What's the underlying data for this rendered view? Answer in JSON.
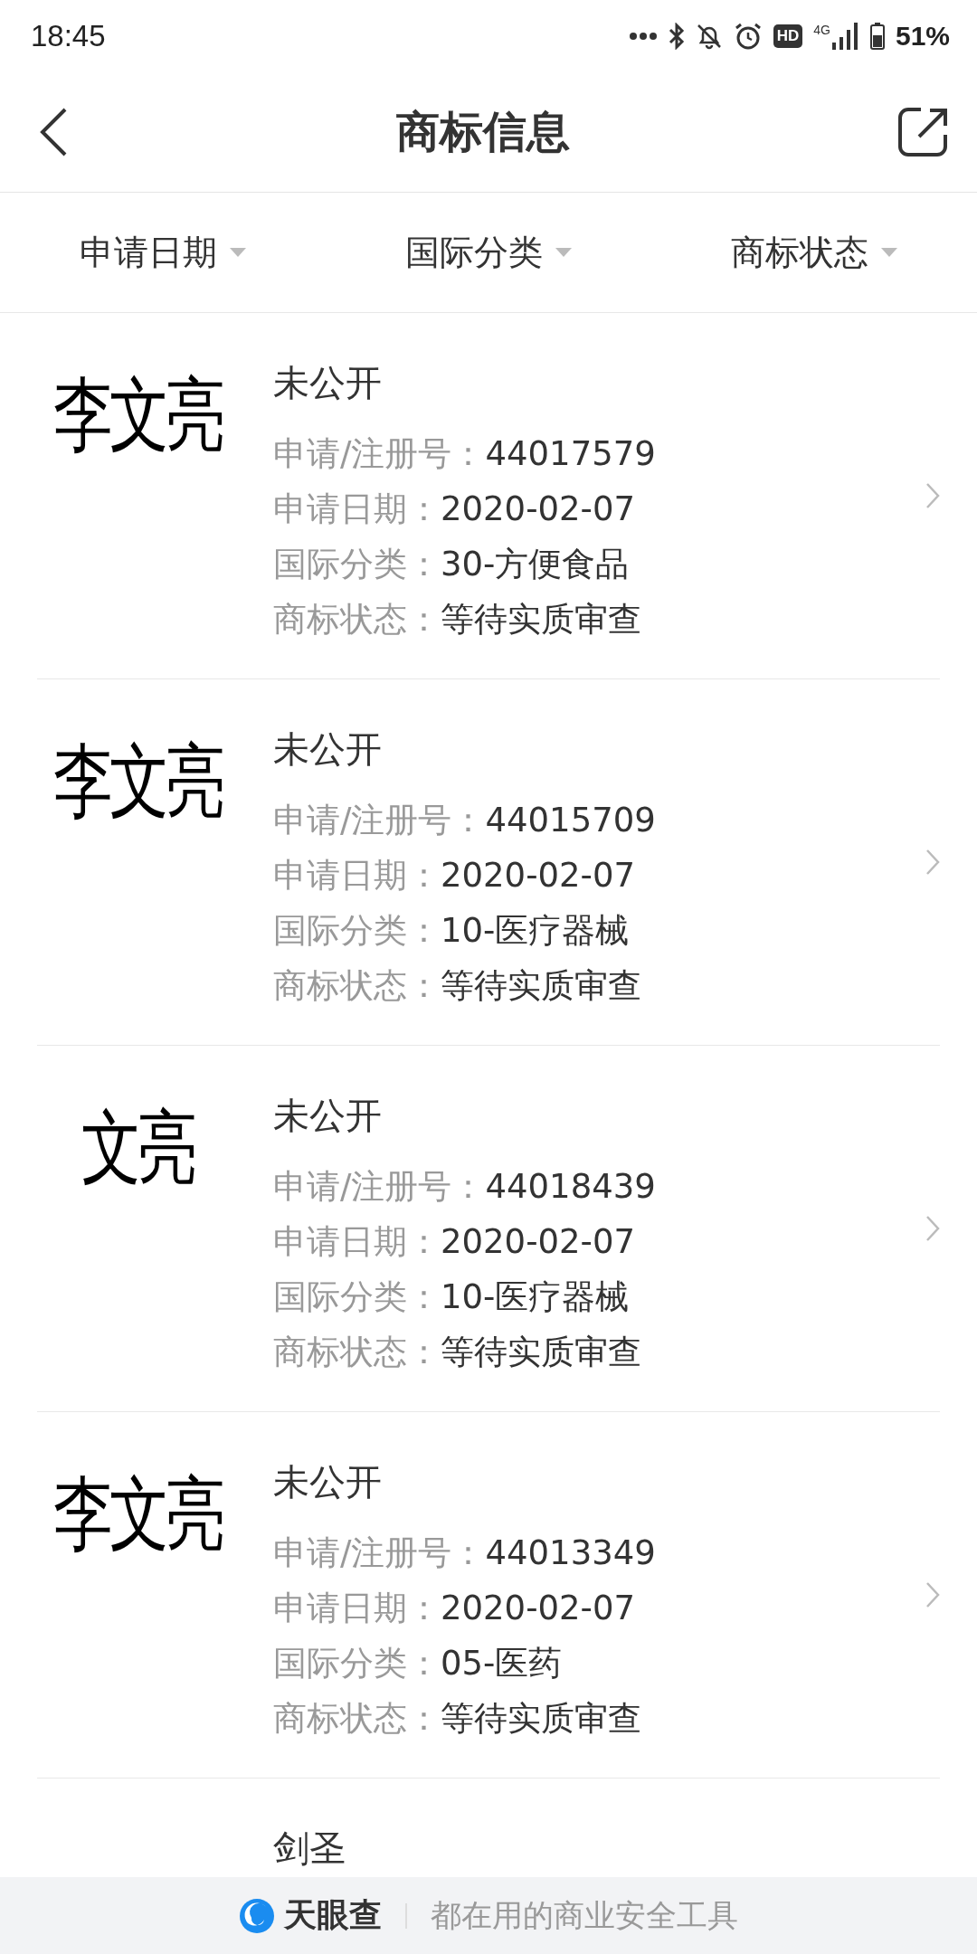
{
  "status_bar": {
    "time": "18:45",
    "hd_badge": "HD",
    "network_type": "4G",
    "battery": "51%"
  },
  "header": {
    "title": "商标信息"
  },
  "filters": [
    {
      "label": "申请日期"
    },
    {
      "label": "国际分类"
    },
    {
      "label": "商标状态"
    }
  ],
  "trademarks": [
    {
      "mark": "李文亮",
      "name": "未公开",
      "fields": [
        {
          "label": "申请/注册号：",
          "value": "44017579"
        },
        {
          "label": "申请日期：",
          "value": "2020-02-07"
        },
        {
          "label": "国际分类：",
          "value": "30-方便食品"
        },
        {
          "label": "商标状态：",
          "value": "等待实质审查"
        }
      ]
    },
    {
      "mark": "李文亮",
      "name": "未公开",
      "fields": [
        {
          "label": "申请/注册号：",
          "value": "44015709"
        },
        {
          "label": "申请日期：",
          "value": "2020-02-07"
        },
        {
          "label": "国际分类：",
          "value": "10-医疗器械"
        },
        {
          "label": "商标状态：",
          "value": "等待实质审查"
        }
      ]
    },
    {
      "mark": "文亮",
      "name": "未公开",
      "fields": [
        {
          "label": "申请/注册号：",
          "value": "44018439"
        },
        {
          "label": "申请日期：",
          "value": "2020-02-07"
        },
        {
          "label": "国际分类：",
          "value": "10-医疗器械"
        },
        {
          "label": "商标状态：",
          "value": "等待实质审查"
        }
      ]
    },
    {
      "mark": "李文亮",
      "name": "未公开",
      "fields": [
        {
          "label": "申请/注册号：",
          "value": "44013349"
        },
        {
          "label": "申请日期：",
          "value": "2020-02-07"
        },
        {
          "label": "国际分类：",
          "value": "05-医药"
        },
        {
          "label": "商标状态：",
          "value": "等待实质审查"
        }
      ]
    },
    {
      "name": "剑圣"
    }
  ],
  "footer": {
    "brand": "天眼查",
    "slogan": "都在用的商业安全工具"
  }
}
